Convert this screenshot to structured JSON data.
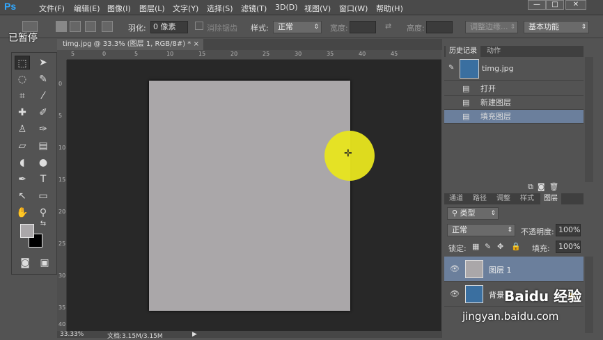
{
  "app": {
    "logo": "Ps"
  },
  "menu": [
    "文件(F)",
    "编辑(E)",
    "图像(I)",
    "图层(L)",
    "文字(Y)",
    "选择(S)",
    "滤镜(T)",
    "3D(D)",
    "视图(V)",
    "窗口(W)",
    "帮助(H)"
  ],
  "window_buttons": [
    "—",
    "□",
    "✕"
  ],
  "options": {
    "feather_label": "羽化:",
    "feather_value": "0 像素",
    "antialias_label": "消除锯齿",
    "style_label": "样式:",
    "style_value": "正常",
    "width_label": "宽度:",
    "height_label": "高度:",
    "refine_button": "调整边缘...",
    "workspace": "基本功能"
  },
  "overlay": {
    "paused": "已暂停"
  },
  "document": {
    "tab_title": "timg.jpg @ 33.3% (图层 1, RGB/8#) *",
    "fill_color": "#aaa7a9",
    "ruler_top": [
      "5",
      "0",
      "5",
      "10",
      "15",
      "20",
      "25",
      "30",
      "35",
      "40",
      "45"
    ],
    "ruler_left": [
      "0",
      "5",
      "10",
      "15",
      "20",
      "25",
      "30",
      "35",
      "40"
    ]
  },
  "status": {
    "zoom": "33.33%",
    "doc_info": "文档:3.15M/3.15M"
  },
  "history_panel": {
    "tabs": [
      "历史记录",
      "动作"
    ],
    "snapshot_name": "timg.jpg",
    "items": [
      "打开",
      "新建图层",
      "填充图层"
    ]
  },
  "layers_panel": {
    "tabs": [
      "通道",
      "路径",
      "调整",
      "样式",
      "图层"
    ],
    "filter_kind": "类型",
    "blend_mode": "正常",
    "opacity_label": "不透明度:",
    "opacity_value": "100%",
    "lock_label": "锁定:",
    "fill_label": "填充:",
    "fill_value": "100%",
    "layers": [
      {
        "name": "图层 1",
        "selected": true
      },
      {
        "name": "背景",
        "selected": false
      }
    ]
  },
  "watermark": {
    "brand": "Baidu 经验",
    "url": "jingyan.baidu.com"
  },
  "colors": {
    "accent": "#31a8ff",
    "selected_row": "#6b7f9c",
    "cursor_highlight": "#e8e51e"
  }
}
